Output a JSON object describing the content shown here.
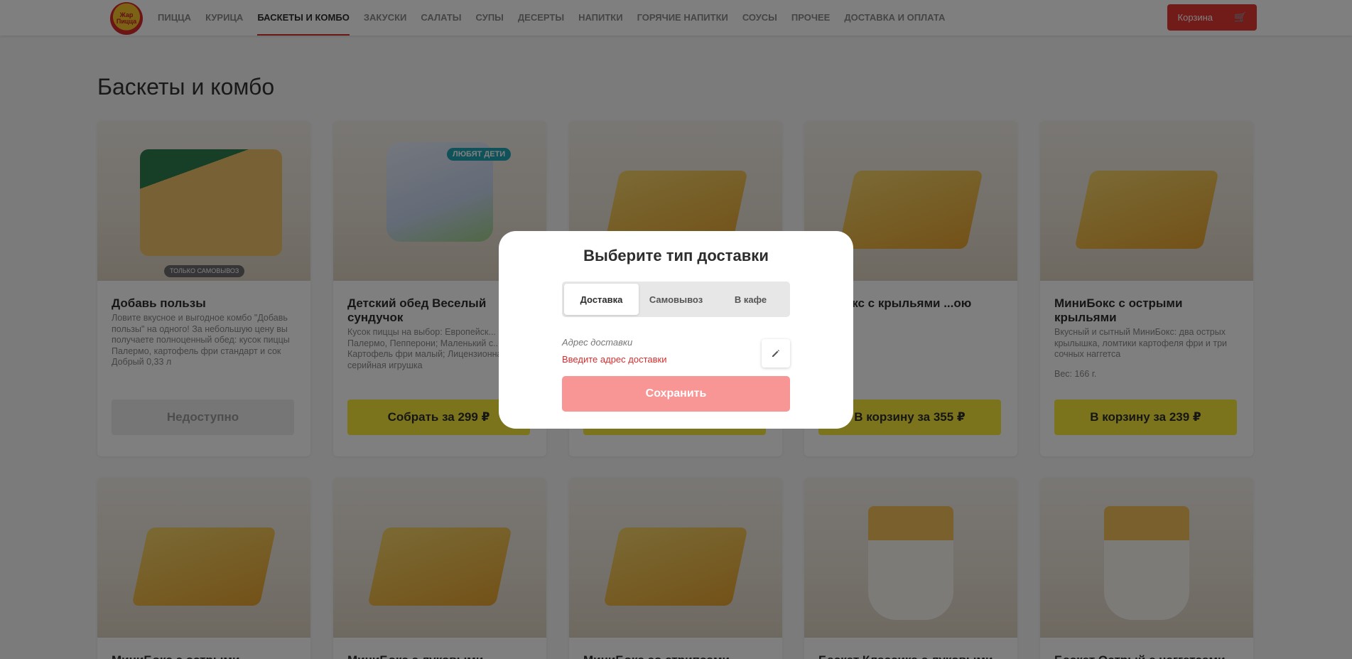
{
  "header": {
    "logo_text": "Жар Пицца",
    "nav": [
      {
        "label": "ПИЦЦА"
      },
      {
        "label": "КУРИЦА"
      },
      {
        "label": "БАСКЕТЫ И КОМБО",
        "active": true
      },
      {
        "label": "ЗАКУСКИ"
      },
      {
        "label": "САЛАТЫ"
      },
      {
        "label": "СУПЫ"
      },
      {
        "label": "ДЕСЕРТЫ"
      },
      {
        "label": "НАПИТКИ"
      },
      {
        "label": "ГОРЯЧИЕ НАПИТКИ"
      },
      {
        "label": "СОУСЫ"
      },
      {
        "label": "ПРОЧЕЕ"
      },
      {
        "label": "ДОСТАВКА И ОПЛАТА"
      }
    ],
    "cart_label": "Корзина",
    "cart_icon": "cart-icon"
  },
  "main": {
    "title": "Баскеты и комбо",
    "cards": [
      {
        "name": "Добавь пользы",
        "badge": "ТОЛЬКО САМОВЫВОЗ",
        "desc": "Ловите вкусное и выгодное комбо \"Добавь пользы\" на одного! За небольшую цену вы получаете полноценный обед: кусок пиццы Палермо, картофель фри стандарт и сок Добрый 0,33 л",
        "button": "Недоступно",
        "disabled": true
      },
      {
        "name": "Детский обед Веселый сундучок",
        "badge": "ЛЮБЯТ ДЕТИ",
        "desc": "Кусок пиццы на выбор: Европейск... Палермо, Пепперони; Маленький с... выбор; Картофель фри малый; Лицензионная серийная игрушка",
        "button": "Собрать за 299 ₽"
      },
      {
        "name": "",
        "desc": "",
        "button": ""
      },
      {
        "name": "...иБокс с крыльями ...ою",
        "desc": "... г.",
        "button": "В корзину за 355 ₽"
      },
      {
        "name": "МиниБокс с острыми крыльями",
        "desc": "Вкусный и сытный МиниБокс: два острых крылышка, ломтики картофеля фри и три сочных наггетса",
        "weight": "Вес: 166 г.",
        "button": "В корзину за 239 ₽"
      },
      {
        "name": "МиниБокс с острыми..."
      },
      {
        "name": "МиниБокс с луковыми..."
      },
      {
        "name": "МиниБокс со стрипсами..."
      },
      {
        "name": "Баскет Классика с луковыми..."
      },
      {
        "name": "Баскет Острый с наггетсами..."
      }
    ]
  },
  "modal": {
    "title": "Выберите тип доставки",
    "tabs": [
      {
        "label": "Доставка",
        "active": true
      },
      {
        "label": "Самовывоз"
      },
      {
        "label": "В кафе"
      }
    ],
    "address_label": "Адрес доставки",
    "address_error": "Введите адрес доставки",
    "edit_icon": "pencil-icon",
    "save_label": "Сохранить"
  },
  "colors": {
    "accent": "#e53935",
    "button_yellow": "#f7e83b",
    "save_disabled": "#f89595",
    "error": "#d32f2f"
  }
}
